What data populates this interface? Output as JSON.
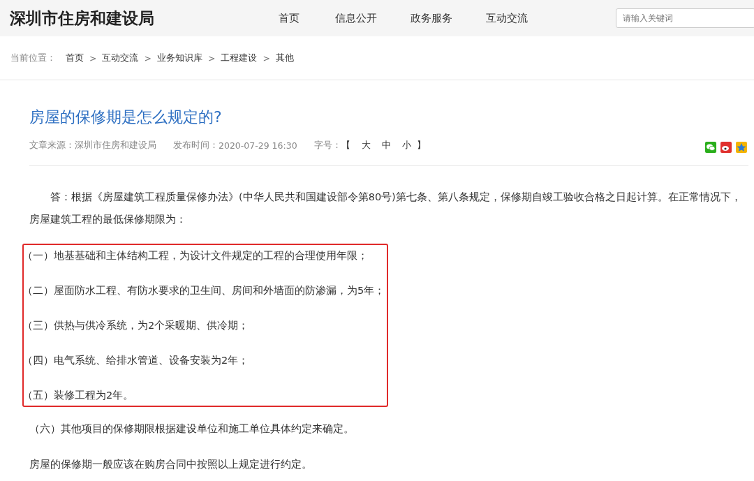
{
  "header": {
    "site_title": "深圳市住房和建设局",
    "nav": [
      {
        "label": "首页"
      },
      {
        "label": "信息公开"
      },
      {
        "label": "政务服务"
      },
      {
        "label": "互动交流"
      }
    ],
    "search": {
      "placeholder": "请输入关键词"
    }
  },
  "breadcrumb": {
    "label": "当前位置：",
    "items": [
      "首页",
      "互动交流",
      "业务知识库",
      "工程建设",
      "其他"
    ],
    "separator": ">"
  },
  "article": {
    "title": "房屋的保修期是怎么规定的?",
    "meta": {
      "source_label": "文章来源：",
      "source": "深圳市住房和建设局",
      "time_label": "发布时间：",
      "time": "2020-07-29 16:30",
      "font_label": "字号：",
      "bracket_open": "【",
      "sizes": [
        "大",
        "中",
        "小"
      ],
      "bracket_close": "】"
    },
    "share": [
      {
        "kind": "wechat",
        "color": "#2aae1b"
      },
      {
        "kind": "weibo",
        "color": "#e0312e"
      },
      {
        "kind": "qzone",
        "color": "#f5b400"
      }
    ],
    "intro": "答：根据《房屋建筑工程质量保修办法》(中华人民共和国建设部令第80号)第七条、第八条规定，保修期自竣工验收合格之日起计算。在正常情况下，房屋建筑工程的最低保修期限为：",
    "items": [
      {
        "text": "（一）地基基础和主体结构工程，为设计文件规定的工程的合理使用年限；",
        "highlighted": true
      },
      {
        "text": "（二）屋面防水工程、有防水要求的卫生间、房间和外墙面的防渗漏，为5年；",
        "highlighted": true
      },
      {
        "text": "（三）供热与供冷系统，为2个采暖期、供冷期；",
        "highlighted": true
      },
      {
        "text": "（四）电气系统、给排水管道、设备安装为2年；",
        "highlighted": true
      },
      {
        "text": "（五）装修工程为2年。",
        "highlighted": true
      },
      {
        "text": "（六）其他项目的保修期限根据建设单位和施工单位具体约定来确定。",
        "highlighted": false
      }
    ],
    "closing": "房屋的保修期一般应该在购房合同中按照以上规定进行约定。"
  }
}
